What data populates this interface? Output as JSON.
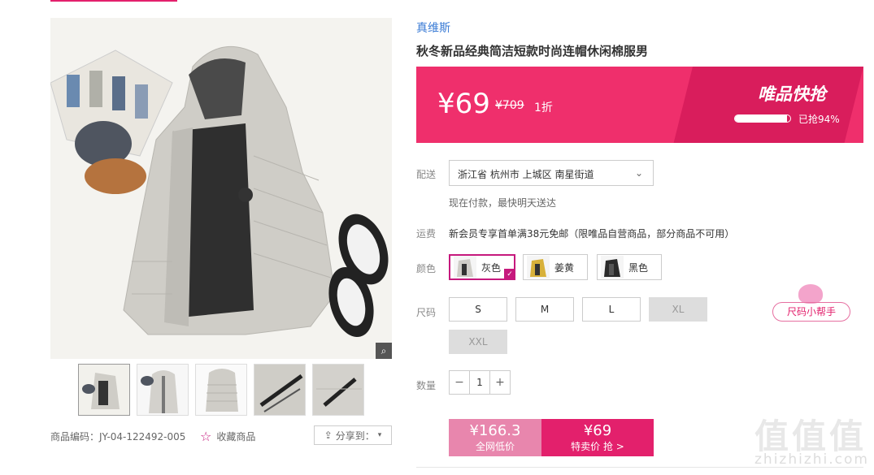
{
  "product": {
    "brand": "真维斯",
    "title": "秋冬新品经典简洁短款时尚连帽休闲棉服男",
    "sku_label": "商品编码：JY-04-122492-005",
    "favorite_label": "收藏商品",
    "share_label": "分享到："
  },
  "banner": {
    "price": "¥69",
    "original_price": "¥709",
    "discount": "1折",
    "flash_label": "唯品快抢",
    "sold_text": "已抢94%",
    "sold_fraction": 0.94
  },
  "delivery": {
    "label": "配送",
    "address": "浙江省 杭州市 上城区 南星街道",
    "note": "现在付款，最快明天送达"
  },
  "shipping": {
    "label": "运费",
    "text": "新会员专享首单满38元免邮（限唯品自营商品，部分商品不可用）"
  },
  "colors": {
    "label": "颜色",
    "options": [
      "灰色",
      "姜黄",
      "黑色"
    ],
    "selected": "灰色"
  },
  "sizes": {
    "label": "尺码",
    "options": [
      "S",
      "M",
      "L",
      "XL",
      "XXL"
    ],
    "disabled": [
      "XL",
      "XXL"
    ],
    "helper_label": "尺码小帮手"
  },
  "quantity": {
    "label": "数量",
    "value": "1",
    "minus": "−",
    "plus": "+"
  },
  "buttons": {
    "net_price": "¥166.3",
    "net_label": "全网低价",
    "buy_price": "¥69",
    "buy_label": "特卖价 抢 >"
  },
  "watermark": {
    "main": "值值值",
    "url": "zhizhizhi.com"
  },
  "colors_theme": {
    "accent": "#e3206c",
    "banner": "#ef2f6c",
    "link": "#3a7bd5"
  }
}
